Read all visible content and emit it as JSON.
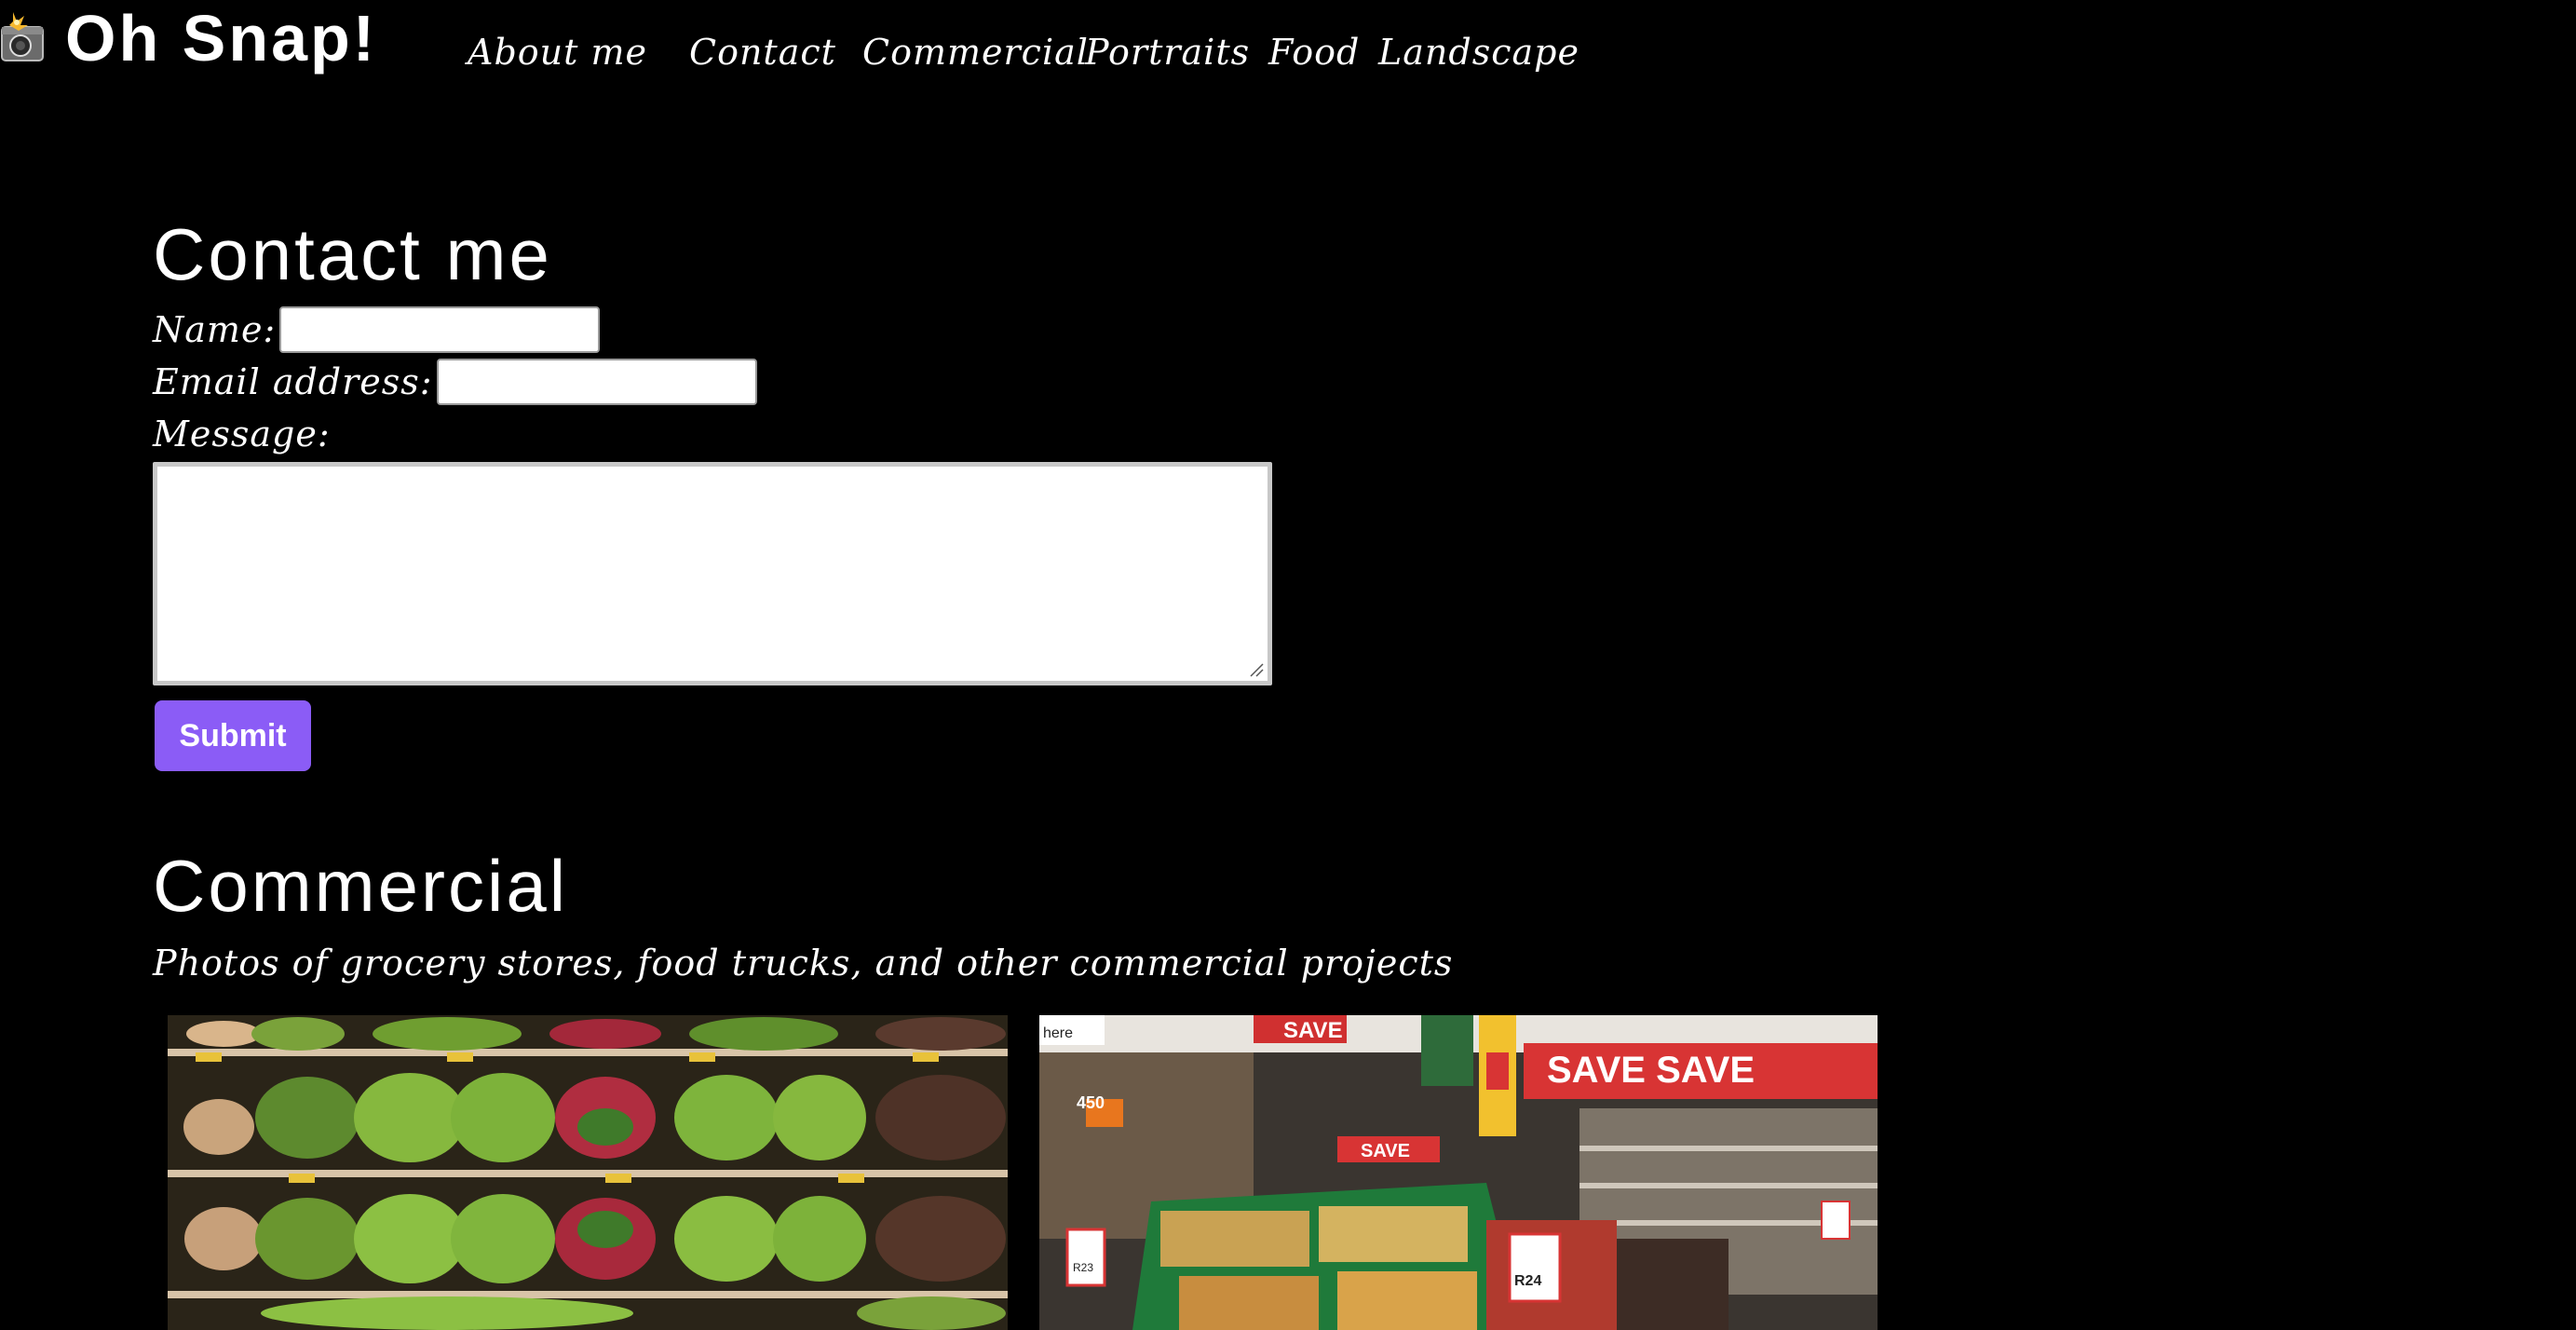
{
  "header": {
    "logo_text": "Oh Snap!",
    "logo_icon": "camera-flash-icon",
    "nav": [
      {
        "label": "About me"
      },
      {
        "label": "Contact"
      },
      {
        "label": "Commercial"
      },
      {
        "label": "Portraits"
      },
      {
        "label": "Food"
      },
      {
        "label": "Landscape"
      }
    ]
  },
  "contact": {
    "title": "Contact me",
    "name_label": "Name:",
    "name_value": "",
    "email_label": "Email address:",
    "email_value": "",
    "message_label": "Message:",
    "message_value": "",
    "submit_label": "Submit"
  },
  "commercial": {
    "title": "Commercial",
    "subtitle": "Photos of grocery stores, food trucks, and other commercial projects",
    "photos": [
      {
        "subject": "vegetable shelves with lettuce, radishes and beets"
      },
      {
        "subject": "supermarket aisle with fruit display and SAVE signs"
      }
    ]
  },
  "colors": {
    "background": "#000000",
    "text": "#ffffff",
    "button": "#8b5cf6"
  }
}
